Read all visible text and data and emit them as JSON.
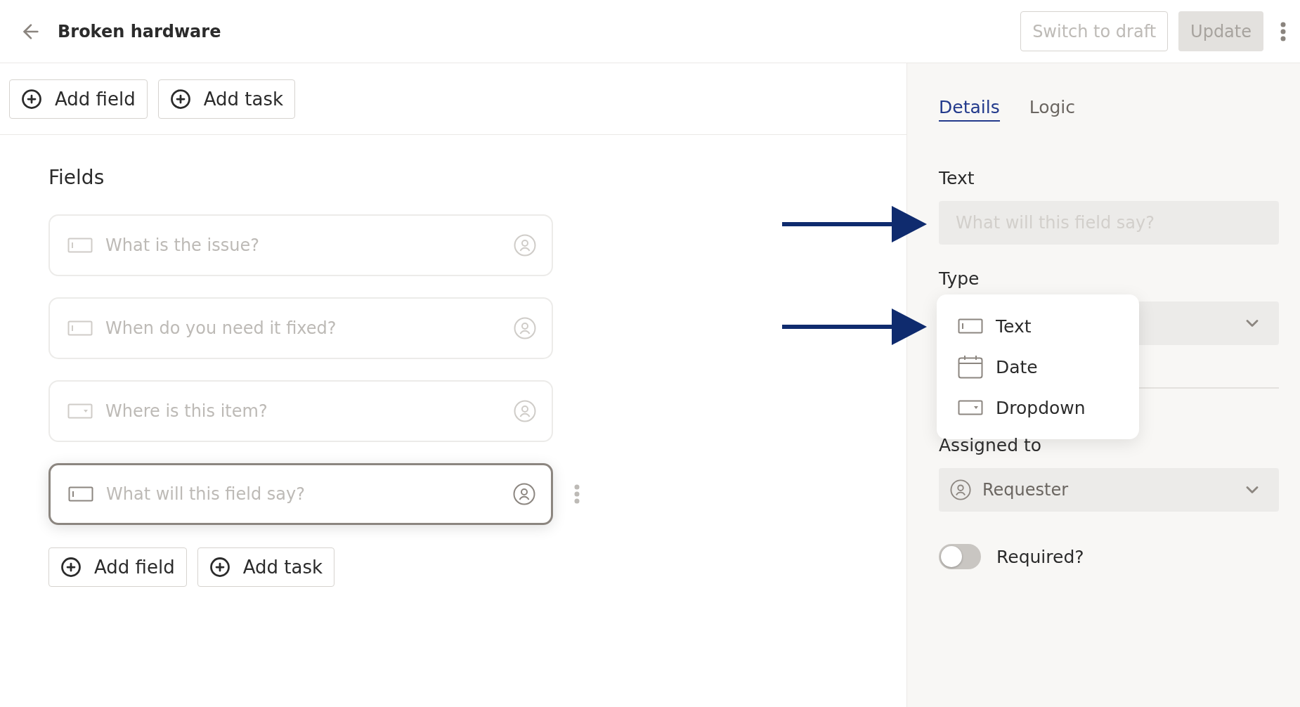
{
  "header": {
    "title": "Broken hardware",
    "buttons": [
      {
        "label": "Switch to draft",
        "kind": "outline",
        "disabled": true
      },
      {
        "label": "Update",
        "kind": "filled",
        "disabled": true
      }
    ]
  },
  "toolbar": {
    "buttons": [
      "Add field",
      "Add task"
    ]
  },
  "fields_section": {
    "heading": "Fields",
    "fields": [
      {
        "placeholder": "What is the issue?",
        "kind": "text",
        "selected": false
      },
      {
        "placeholder": "When do you need it fixed?",
        "kind": "text",
        "selected": false
      },
      {
        "placeholder": "Where is this item?",
        "kind": "dropdown",
        "selected": false
      },
      {
        "placeholder": "What will this field say?",
        "kind": "text",
        "selected": true
      }
    ],
    "buttons": [
      "Add field",
      "Add task"
    ]
  },
  "panel": {
    "tabs": [
      {
        "label": "Details",
        "selected": true
      },
      {
        "label": "Logic",
        "selected": false
      }
    ],
    "text_label": "Text",
    "text_placeholder": "What will this field say?",
    "type_label": "Type",
    "type_menu": [
      {
        "label": "Text",
        "kind": "text"
      },
      {
        "label": "Date",
        "kind": "date"
      },
      {
        "label": "Dropdown",
        "kind": "dropdown"
      }
    ],
    "assigned_label": "Assigned to",
    "assigned_value": "Requester",
    "required": {
      "label": "Required?",
      "on": false
    }
  }
}
